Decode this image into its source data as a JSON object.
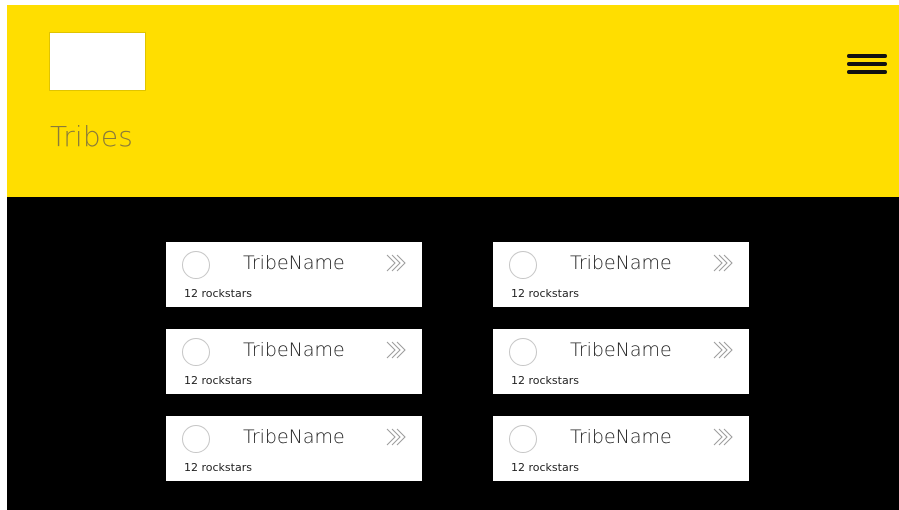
{
  "header": {
    "title": "Tribes",
    "menu_icon": "hamburger-icon"
  },
  "tribes": [
    {
      "name": "TribeName",
      "count": "12 rockstars"
    },
    {
      "name": "TribeName",
      "count": "12 rockstars"
    },
    {
      "name": "TribeName",
      "count": "12 rockstars"
    },
    {
      "name": "TribeName",
      "count": "12 rockstars"
    },
    {
      "name": "TribeName",
      "count": "12 rockstars"
    },
    {
      "name": "TribeName",
      "count": "12 rockstars"
    }
  ],
  "colors": {
    "header_bg": "#ffde00",
    "content_bg": "#000000",
    "card_bg": "#ffffff",
    "title_text": "#8a7b3a"
  },
  "icons": {
    "tribe_avatar": "avatar-circle-icon",
    "card_chevron": "chevron-right-icon"
  }
}
